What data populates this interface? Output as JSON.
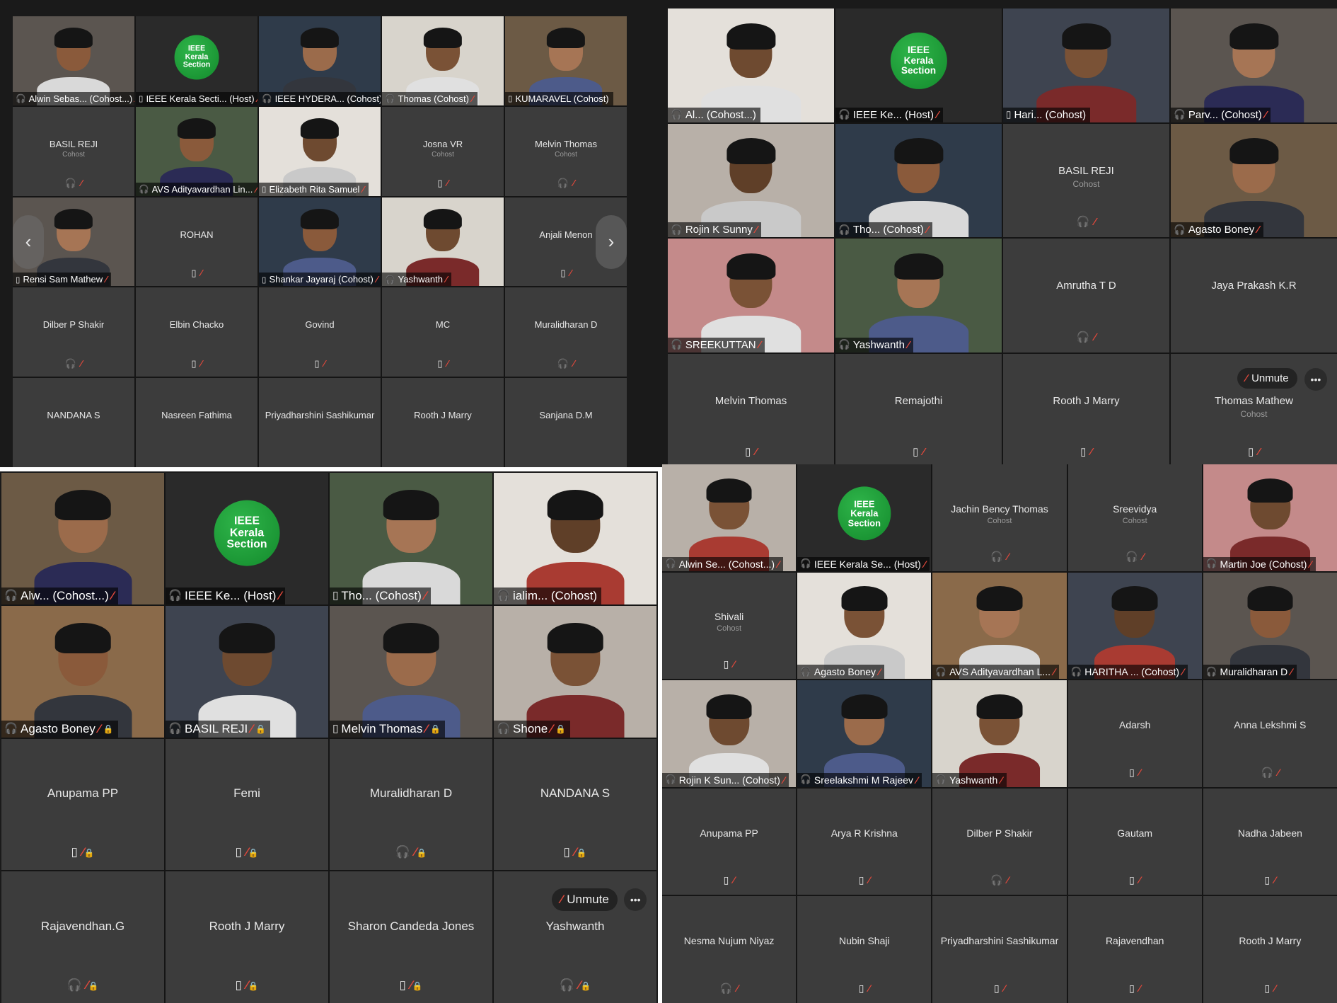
{
  "colors": {
    "muted_icon": "#e0483b",
    "tile_bg": "#3c3c3c",
    "ieee_green": "#1fa23a"
  },
  "icons": {
    "mic": "headset-icon",
    "phone": "phone-icon",
    "muted": "mic-muted-icon",
    "more": "more-icon",
    "prev": "chevron-left-icon",
    "next": "chevron-right-icon"
  },
  "ieee_logo": {
    "line1": "IEEE",
    "line2": "Kerala",
    "line3": "Section"
  },
  "panels": [
    {
      "cols": 5,
      "tiles": [
        {
          "type": "video",
          "label": "Alwin Sebas... (Cohost...)",
          "icon": "mic",
          "muted": true
        },
        {
          "type": "logo",
          "label": "IEEE Kerala Secti... (Host)",
          "icon": "phone",
          "muted": true
        },
        {
          "type": "video",
          "label": "IEEE HYDERA... (Cohost)",
          "icon": "mic",
          "muted": true
        },
        {
          "type": "video",
          "label": "Thomas (Cohost)",
          "icon": "mic",
          "muted": true
        },
        {
          "type": "video",
          "label": "KUMARAVEL (Cohost)",
          "icon": "phone",
          "muted": false
        },
        {
          "type": "name",
          "name": "BASIL REJI",
          "role": "Cohost",
          "icon": "mic",
          "muted": true
        },
        {
          "type": "video",
          "label": "AVS Adityavardhan Lin...",
          "icon": "mic",
          "muted": true
        },
        {
          "type": "video",
          "label": "Elizabeth Rita Samuel",
          "icon": "phone",
          "muted": true
        },
        {
          "type": "name",
          "name": "Josna VR",
          "role": "Cohost",
          "icon": "phone",
          "muted": true
        },
        {
          "type": "name",
          "name": "Melvin Thomas",
          "role": "Cohost",
          "icon": "mic",
          "muted": true
        },
        {
          "type": "video",
          "label": "Rensi Sam Mathew",
          "icon": "phone",
          "muted": true
        },
        {
          "type": "name",
          "name": "ROHAN",
          "role": "",
          "icon": "phone",
          "muted": true
        },
        {
          "type": "video",
          "label": "Shankar Jayaraj (Cohost)",
          "icon": "phone",
          "muted": true
        },
        {
          "type": "video",
          "label": "Yashwanth",
          "icon": "mic",
          "muted": true
        },
        {
          "type": "name",
          "name": "Anjali Menon",
          "role": "",
          "icon": "phone",
          "muted": true
        },
        {
          "type": "name",
          "name": "Dilber P Shakir",
          "role": "",
          "icon": "mic",
          "muted": true
        },
        {
          "type": "name",
          "name": "Elbin Chacko",
          "role": "",
          "icon": "phone",
          "muted": true
        },
        {
          "type": "name",
          "name": "Govind",
          "role": "",
          "icon": "phone",
          "muted": true
        },
        {
          "type": "name",
          "name": "MC",
          "role": "",
          "icon": "phone",
          "muted": true
        },
        {
          "type": "name",
          "name": "Muralidharan D",
          "role": "",
          "icon": "mic",
          "muted": true
        },
        {
          "type": "name",
          "name": "NANDANA S",
          "role": "",
          "icon": "",
          "muted": false
        },
        {
          "type": "name",
          "name": "Nasreen Fathima",
          "role": "",
          "icon": "",
          "muted": false
        },
        {
          "type": "name",
          "name": "Priyadharshini Sashikumar",
          "role": "",
          "icon": "",
          "muted": false
        },
        {
          "type": "name",
          "name": "Rooth J Marry",
          "role": "",
          "icon": "",
          "muted": false
        },
        {
          "type": "name",
          "name": "Sanjana D.M",
          "role": "",
          "icon": "",
          "muted": false
        }
      ]
    },
    {
      "cols": 4,
      "tiles": [
        {
          "type": "video",
          "label": "Al... (Cohost...)",
          "icon": "mic",
          "muted": false
        },
        {
          "type": "logo",
          "label": "IEEE Ke... (Host)",
          "icon": "mic",
          "muted": true
        },
        {
          "type": "video",
          "label": "Hari... (Cohost)",
          "icon": "phone",
          "muted": false
        },
        {
          "type": "video",
          "label": "Parv... (Cohost)",
          "icon": "mic",
          "muted": true
        },
        {
          "type": "video",
          "label": "Rojin K Sunny",
          "icon": "mic",
          "muted": true
        },
        {
          "type": "video",
          "label": "Tho... (Cohost)",
          "icon": "mic",
          "muted": true
        },
        {
          "type": "name",
          "name": "BASIL REJI",
          "role": "Cohost",
          "icon": "mic",
          "muted": true
        },
        {
          "type": "video",
          "label": "Agasto Boney",
          "icon": "mic",
          "muted": true
        },
        {
          "type": "video",
          "label": "SREEKUTTAN",
          "icon": "mic",
          "muted": true
        },
        {
          "type": "video",
          "label": "Yashwanth",
          "icon": "mic",
          "muted": true
        },
        {
          "type": "name",
          "name": "Amrutha T D",
          "role": "",
          "icon": "mic",
          "muted": true
        },
        {
          "type": "name",
          "name": "Jaya Prakash K.R",
          "role": "",
          "icon": "",
          "muted": false
        },
        {
          "type": "name",
          "name": "Melvin Thomas",
          "role": "",
          "icon": "phone",
          "muted": true
        },
        {
          "type": "name",
          "name": "Remajothi",
          "role": "",
          "icon": "phone",
          "muted": true
        },
        {
          "type": "name",
          "name": "Rooth J Marry",
          "role": "",
          "icon": "phone",
          "muted": true
        },
        {
          "type": "name",
          "name": "Thomas Mathew",
          "role": "Cohost",
          "icon": "phone",
          "muted": true,
          "unmute": "Unmute"
        }
      ]
    },
    {
      "cols": 4,
      "tiles": [
        {
          "type": "video",
          "label": "Alw... (Cohost...)",
          "icon": "mic",
          "muted": true
        },
        {
          "type": "logo",
          "label": "IEEE Ke... (Host)",
          "icon": "mic",
          "muted": true
        },
        {
          "type": "video",
          "label": "Tho... (Cohost)",
          "icon": "phone",
          "muted": true
        },
        {
          "type": "video",
          "label": "ialim... (Cohost)",
          "icon": "mic",
          "muted": false
        },
        {
          "type": "video",
          "label": "Agasto Boney",
          "icon": "mic",
          "muted": true,
          "lock": true
        },
        {
          "type": "video",
          "label": "BASIL REJI",
          "icon": "mic",
          "muted": true,
          "lock": true
        },
        {
          "type": "video",
          "label": "Melvin Thomas",
          "icon": "phone",
          "muted": true,
          "lock": true
        },
        {
          "type": "video",
          "label": "Shone",
          "icon": "mic",
          "muted": true,
          "lock": true
        },
        {
          "type": "name",
          "name": "Anupama PP",
          "role": "",
          "icon": "phone",
          "muted": true,
          "lock": true
        },
        {
          "type": "name",
          "name": "Femi",
          "role": "",
          "icon": "phone",
          "muted": true,
          "lock": true
        },
        {
          "type": "name",
          "name": "Muralidharan D",
          "role": "",
          "icon": "mic",
          "muted": true,
          "lock": true
        },
        {
          "type": "name",
          "name": "NANDANA S",
          "role": "",
          "icon": "phone",
          "muted": true,
          "lock": true
        },
        {
          "type": "name",
          "name": "Rajavendhan.G",
          "role": "",
          "icon": "mic",
          "muted": true,
          "lock": true
        },
        {
          "type": "name",
          "name": "Rooth J Marry",
          "role": "",
          "icon": "phone",
          "muted": true,
          "lock": true
        },
        {
          "type": "name",
          "name": "Sharon Candeda Jones",
          "role": "",
          "icon": "phone",
          "muted": true,
          "lock": true
        },
        {
          "type": "name",
          "name": "Yashwanth",
          "role": "",
          "icon": "mic",
          "muted": true,
          "lock": true,
          "unmute": "Unmute"
        }
      ]
    },
    {
      "cols": 5,
      "tiles": [
        {
          "type": "video",
          "label": "Alwin Se... (Cohost...)",
          "icon": "mic",
          "muted": true
        },
        {
          "type": "logo",
          "label": "IEEE Kerala Se... (Host)",
          "icon": "mic",
          "muted": true
        },
        {
          "type": "name",
          "name": "Jachin Bency Thomas",
          "role": "Cohost",
          "icon": "mic",
          "muted": true
        },
        {
          "type": "name",
          "name": "Sreevidya",
          "role": "Cohost",
          "icon": "mic",
          "muted": true
        },
        {
          "type": "video",
          "label": "Martin Joe (Cohost)",
          "icon": "mic",
          "muted": true
        },
        {
          "type": "name",
          "name": "Shivali",
          "role": "Cohost",
          "icon": "phone",
          "muted": true
        },
        {
          "type": "video",
          "label": "Agasto Boney",
          "icon": "mic",
          "muted": true
        },
        {
          "type": "video",
          "label": "AVS Adityavardhan L...",
          "icon": "mic",
          "muted": true
        },
        {
          "type": "video",
          "label": "HARITHA ... (Cohost)",
          "icon": "mic",
          "muted": true
        },
        {
          "type": "video",
          "label": "Muralidharan D",
          "icon": "mic",
          "muted": true
        },
        {
          "type": "video",
          "label": "Rojin K Sun... (Cohost)",
          "icon": "mic",
          "muted": true
        },
        {
          "type": "video",
          "label": "Sreelakshmi M Rajeev",
          "icon": "mic",
          "muted": true
        },
        {
          "type": "video",
          "label": "Yashwanth",
          "icon": "mic",
          "muted": true
        },
        {
          "type": "name",
          "name": "Adarsh",
          "role": "",
          "icon": "phone",
          "muted": true
        },
        {
          "type": "name",
          "name": "Anna Lekshmi S",
          "role": "",
          "icon": "mic",
          "muted": true
        },
        {
          "type": "name",
          "name": "Anupama PP",
          "role": "",
          "icon": "phone",
          "muted": true
        },
        {
          "type": "name",
          "name": "Arya R Krishna",
          "role": "",
          "icon": "phone",
          "muted": true
        },
        {
          "type": "name",
          "name": "Dilber P Shakir",
          "role": "",
          "icon": "mic",
          "muted": true
        },
        {
          "type": "name",
          "name": "Gautam",
          "role": "",
          "icon": "phone",
          "muted": true
        },
        {
          "type": "name",
          "name": "Nadha Jabeen",
          "role": "",
          "icon": "phone",
          "muted": true
        },
        {
          "type": "name",
          "name": "Nesma Nujum Niyaz",
          "role": "",
          "icon": "mic",
          "muted": true
        },
        {
          "type": "name",
          "name": "Nubin Shaji",
          "role": "",
          "icon": "phone",
          "muted": true
        },
        {
          "type": "name",
          "name": "Priyadharshini Sashikumar",
          "role": "",
          "icon": "phone",
          "muted": true
        },
        {
          "type": "name",
          "name": "Rajavendhan",
          "role": "",
          "icon": "phone",
          "muted": true
        },
        {
          "type": "name",
          "name": "Rooth J Marry",
          "role": "",
          "icon": "phone",
          "muted": true
        }
      ]
    }
  ]
}
